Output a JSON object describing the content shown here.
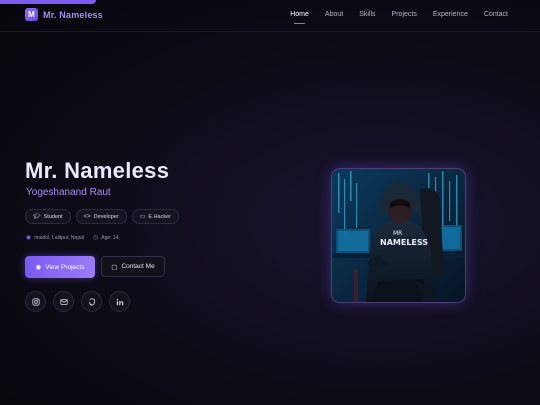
{
  "header": {
    "logo_letter": "M",
    "logo_text": "Mr. Nameless",
    "nav": [
      {
        "label": "Home",
        "active": true
      },
      {
        "label": "About"
      },
      {
        "label": "Skills"
      },
      {
        "label": "Projects"
      },
      {
        "label": "Experience"
      },
      {
        "label": "Contact"
      }
    ]
  },
  "hero": {
    "title": "Mr. Nameless",
    "subtitle": "Yogeshanand Raut",
    "chips": [
      {
        "icon": "graduation-cap-icon",
        "label": "Student"
      },
      {
        "icon": "code-icon",
        "label": "Developer"
      },
      {
        "icon": "monitor-icon",
        "label": "E.Hacker"
      }
    ],
    "location": "Imadol, Lalitpur, Nepal",
    "age": "Age:  14",
    "primary_button": "View Projects",
    "secondary_button": "Contact Me",
    "socials": [
      "instagram-icon",
      "mail-icon",
      "github-icon",
      "linkedin-icon"
    ]
  },
  "profile_image": {
    "hoodie_text_1": "MR",
    "hoodie_text_2": "NAMELESS"
  },
  "colors": {
    "accent": "#7c5cf0",
    "accent_light": "#a98df3",
    "background": "#0d0b16"
  }
}
